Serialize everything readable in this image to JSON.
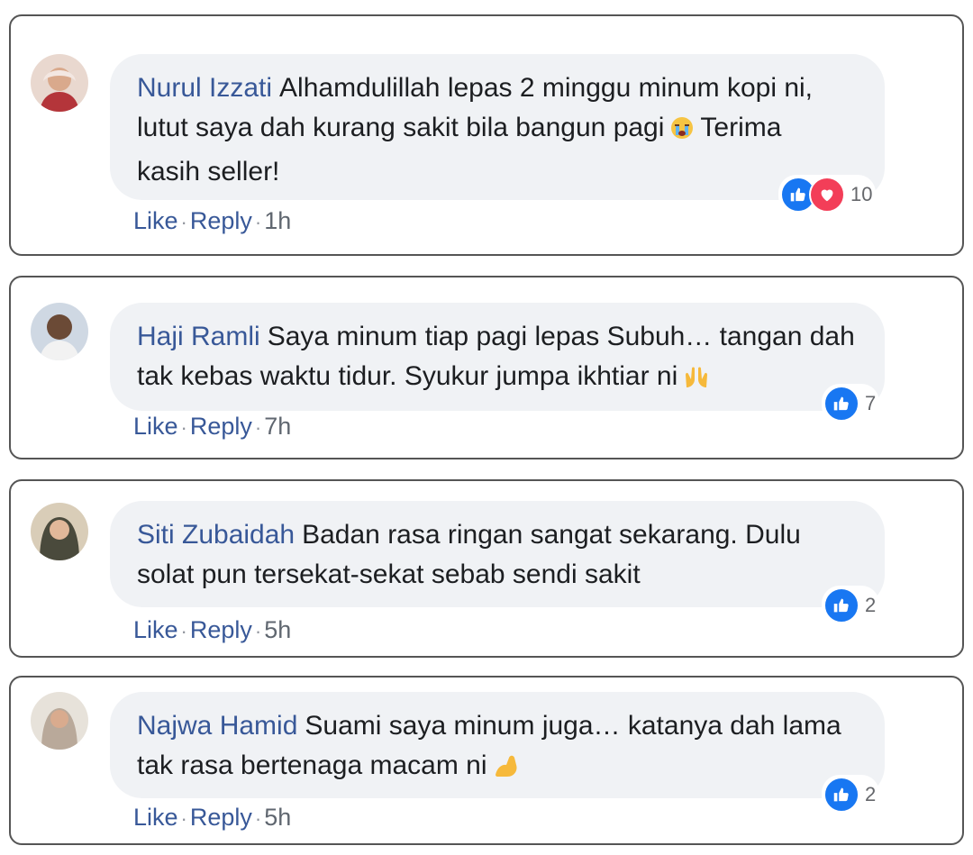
{
  "comments": [
    {
      "author": "Nurul Izzati",
      "text_a": "Alhamdulillah lepas 2 minggu minum kopi ni,",
      "text_b": "lutut saya dah kurang sakit bila bangun pagi",
      "text_c": "Terima",
      "text_d": "kasih seller!",
      "emoji": "crying-face-emoji",
      "like": "Like",
      "reply": "Reply",
      "sep": "·",
      "time": "1h",
      "reaction_count": "10",
      "reactions": [
        "like-icon",
        "love-icon"
      ]
    },
    {
      "author": "Haji Ramli",
      "text_a": "Saya minum tiap pagi lepas Subuh… tangan dah",
      "text_b": "tak kebas waktu tidur. Syukur jumpa ikhtiar ni",
      "emoji": "raising-hands-emoji",
      "like": "Like",
      "reply": "Reply",
      "sep": "·",
      "time": "7h",
      "reaction_count": "7",
      "reactions": [
        "like-icon"
      ]
    },
    {
      "author": "Siti Zubaidah",
      "text_a": "Badan rasa ringan sangat sekarang. Dulu",
      "text_b": "solat pun tersekat-sekat sebab sendi sakit",
      "like": "Like",
      "reply": "Reply",
      "sep": "·",
      "time": "5h",
      "reaction_count": "2",
      "reactions": [
        "like-icon"
      ]
    },
    {
      "author": "Najwa Hamid",
      "text_a": "Suami saya minum juga… katanya dah lama",
      "text_b": "tak rasa bertenaga macam ni",
      "emoji": "flexed-biceps-emoji",
      "like": "Like",
      "reply": "Reply",
      "sep": "·",
      "time": "5h",
      "reaction_count": "2",
      "reactions": [
        "like-icon"
      ]
    }
  ],
  "colors": {
    "link": "#385898",
    "bubble": "#f0f2f5",
    "like": "#1877f2",
    "love": "#f33e58"
  }
}
